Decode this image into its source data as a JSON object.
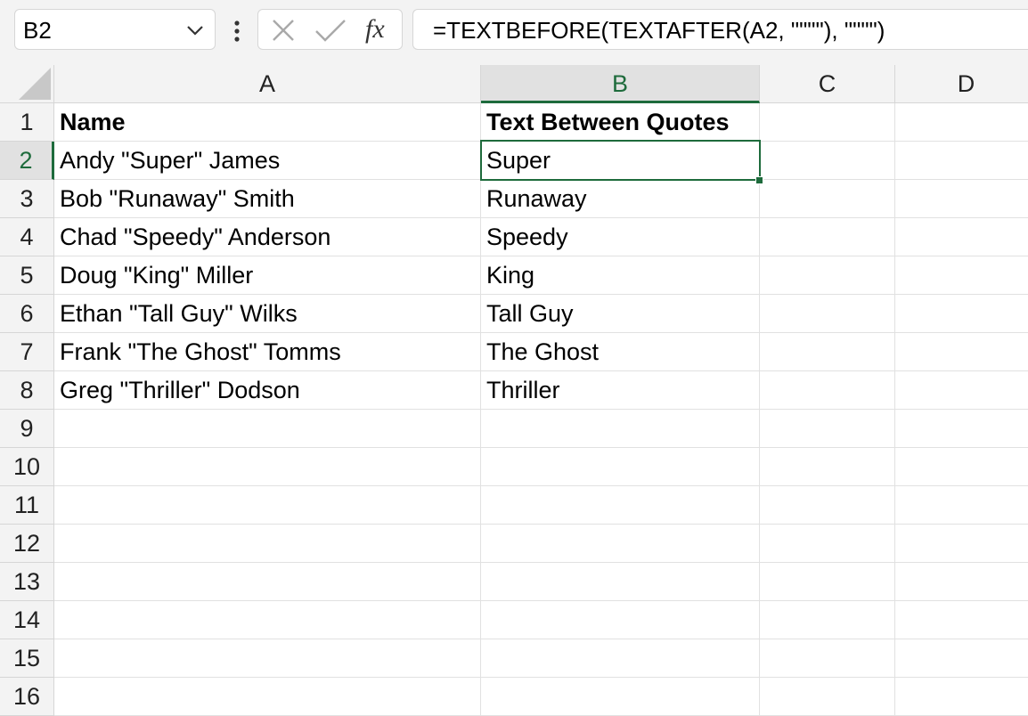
{
  "formula_bar": {
    "name_box": "B2",
    "formula": "=TEXTBEFORE(TEXTAFTER(A2, \"\"\"\"), \"\"\"\")"
  },
  "icons": {
    "name_box_dropdown": "chevron-down-icon",
    "more": "vertical-dots-icon",
    "cancel": "close-icon",
    "enter": "checkmark-icon",
    "insert_function": "fx-icon"
  },
  "columns": [
    "A",
    "B",
    "C",
    "D"
  ],
  "rows": [
    "1",
    "2",
    "3",
    "4",
    "5",
    "6",
    "7",
    "8",
    "9",
    "10",
    "11",
    "12",
    "13",
    "14",
    "15",
    "16"
  ],
  "cells": {
    "A1": "Name",
    "B1": "Text Between Quotes",
    "A2": "Andy \"Super\" James",
    "B2": "Super",
    "A3": "Bob \"Runaway\" Smith",
    "B3": "Runaway",
    "A4": "Chad \"Speedy\" Anderson",
    "B4": "Speedy",
    "A5": "Doug \"King\" Miller",
    "B5": "King",
    "A6": "Ethan \"Tall Guy\" Wilks",
    "B6": "Tall Guy",
    "A7": "Frank \"The Ghost\" Tomms",
    "B7": "The Ghost",
    "A8": "Greg \"Thriller\" Dodson",
    "B8": "Thriller"
  },
  "bold_cells": [
    "A1",
    "B1"
  ],
  "active_cell": "B2",
  "colors": {
    "accent": "#1e6b3c",
    "header_bg": "#f3f3f3",
    "gridline": "#e1e1e1"
  }
}
